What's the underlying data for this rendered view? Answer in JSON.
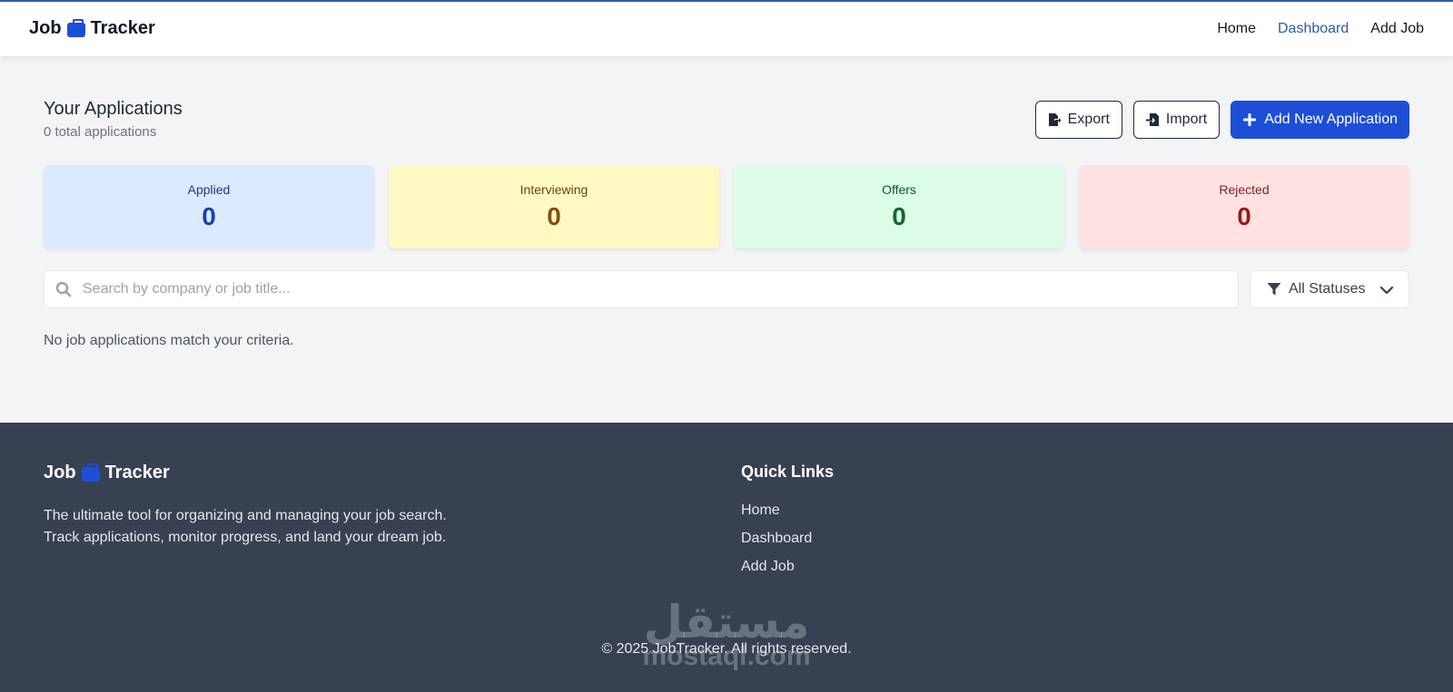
{
  "header": {
    "brand_left": "Job",
    "brand_right": "Tracker",
    "nav": [
      {
        "label": "Home"
      },
      {
        "label": "Dashboard"
      },
      {
        "label": "Add Job"
      }
    ]
  },
  "main": {
    "title": "Your Applications",
    "subtitle": "0 total applications",
    "actions": {
      "export_label": "Export",
      "import_label": "Import",
      "add_label": "Add New Application"
    },
    "stats": [
      {
        "label": "Applied",
        "value": "0"
      },
      {
        "label": "Interviewing",
        "value": "0"
      },
      {
        "label": "Offers",
        "value": "0"
      },
      {
        "label": "Rejected",
        "value": "0"
      }
    ],
    "search_placeholder": "Search by company or job title...",
    "filter_selected": "All Statuses",
    "empty_message": "No job applications match your criteria."
  },
  "footer": {
    "brand_left": "Job",
    "brand_right": "Tracker",
    "description": "The ultimate tool for organizing and managing your job search. Track applications, monitor progress, and land your dream job.",
    "quick_links_title": "Quick Links",
    "quick_links": [
      {
        "label": "Home"
      },
      {
        "label": "Dashboard"
      },
      {
        "label": "Add Job"
      }
    ],
    "copyright": "© 2025 JobTracker. All rights reserved.",
    "watermark_ar": "مستقل",
    "watermark_en": "mostaql.com"
  },
  "colors": {
    "accent": "#1d4ed8",
    "nav_active": "#2b5aa8",
    "footer_bg": "#374151",
    "page_bg": "#f3f4f6"
  },
  "icons": [
    "briefcase-icon",
    "export-icon",
    "import-icon",
    "plus-icon",
    "search-icon",
    "filter-icon",
    "chevron-down-icon"
  ]
}
